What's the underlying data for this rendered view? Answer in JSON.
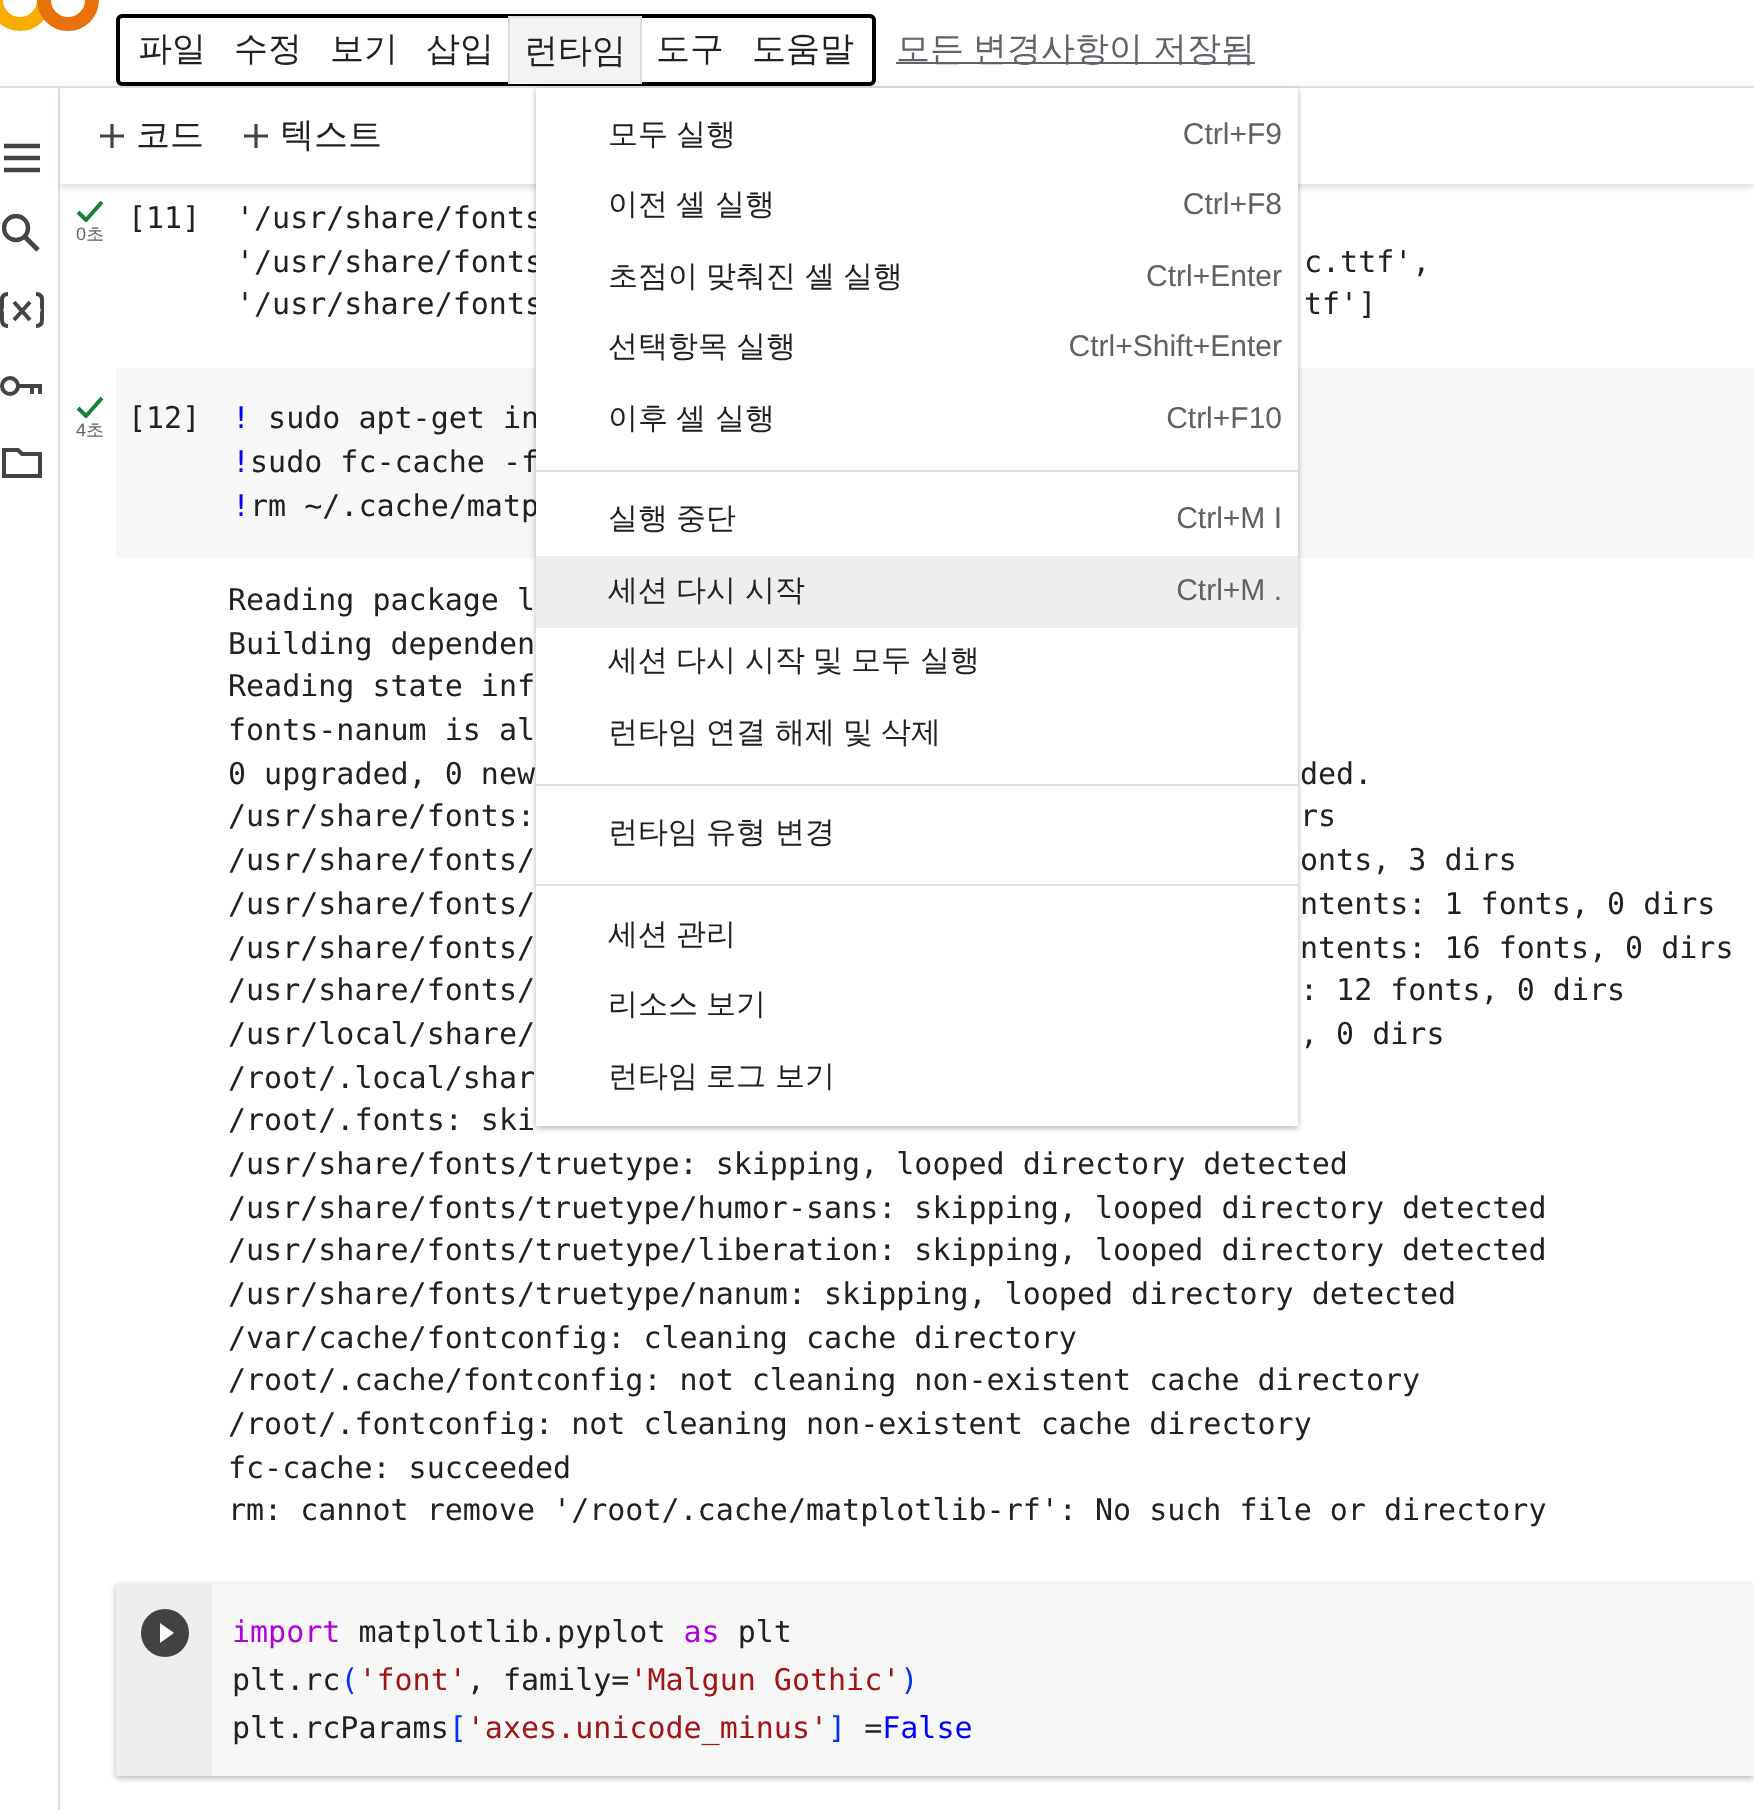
{
  "menubar": {
    "items": [
      {
        "label": "파일",
        "selected": false
      },
      {
        "label": "수정",
        "selected": false
      },
      {
        "label": "보기",
        "selected": false
      },
      {
        "label": "삽입",
        "selected": false
      },
      {
        "label": "런타임",
        "selected": true
      },
      {
        "label": "도구",
        "selected": false
      },
      {
        "label": "도움말",
        "selected": false
      }
    ],
    "save_status": "모든 변경사항이 저장됨"
  },
  "toolbar": {
    "buttons": [
      "코드",
      "텍스트"
    ]
  },
  "cells": [
    {
      "kind": "output_only",
      "status": "0초",
      "count": "[11]",
      "lines": [
        {
          "left": "'/usr/share/fonts"
        },
        {
          "left": "'/usr/share/fonts",
          "right": "c.ttf',"
        },
        {
          "left": "'/usr/share/fonts",
          "right": "tf']"
        }
      ]
    },
    {
      "kind": "shell",
      "status": "4초",
      "count": "[12]",
      "code": [
        {
          "bang": "!",
          "text": " sudo apt-get in"
        },
        {
          "bang": "!",
          "text": "sudo fc-cache -f"
        },
        {
          "bang": "!",
          "text": "rm ~/.cache/matp"
        }
      ],
      "output": [
        {
          "left": "Reading package l"
        },
        {
          "left": "Building dependen"
        },
        {
          "left": "Reading state inf"
        },
        {
          "left": "fonts-nanum is al"
        },
        {
          "left": "0 upgraded, 0 new",
          "right": "ded."
        },
        {
          "left": "/usr/share/fonts:",
          "right": "rs"
        },
        {
          "left": "/usr/share/fonts/",
          "right": "onts, 3 dirs"
        },
        {
          "left": "/usr/share/fonts/",
          "right": "ntents: 1 fonts, 0 dirs"
        },
        {
          "left": "/usr/share/fonts/",
          "right": "ntents: 16 fonts, 0 dirs"
        },
        {
          "left": "/usr/share/fonts/",
          "right": ": 12 fonts, 0 dirs"
        },
        {
          "left": "/usr/local/share/",
          "right": ", 0 dirs"
        },
        {
          "left": "/root/.local/shar"
        },
        {
          "left": "/root/.fonts: ski"
        },
        {
          "left": "/usr/share/fonts/truetype: skipping, looped directory detected"
        },
        {
          "left": "/usr/share/fonts/truetype/humor-sans: skipping, looped directory detected"
        },
        {
          "left": "/usr/share/fonts/truetype/liberation: skipping, looped directory detected"
        },
        {
          "left": "/usr/share/fonts/truetype/nanum: skipping, looped directory detected"
        },
        {
          "left": "/var/cache/fontconfig: cleaning cache directory"
        },
        {
          "left": "/root/.cache/fontconfig: not cleaning non-existent cache directory"
        },
        {
          "left": "/root/.fontconfig: not cleaning non-existent cache directory"
        },
        {
          "left": "fc-cache: succeeded"
        },
        {
          "left": "rm: cannot remove '/root/.cache/matplotlib-rf': No such file or directory"
        }
      ]
    },
    {
      "kind": "python",
      "code": [
        [
          {
            "kind": "keyword",
            "text": "import"
          },
          {
            "kind": "plain",
            "text": " matplotlib.pyplot "
          },
          {
            "kind": "keyword",
            "text": "as"
          },
          {
            "kind": "plain",
            "text": " plt"
          }
        ],
        [
          {
            "kind": "plain",
            "text": "plt.rc"
          },
          {
            "kind": "bracket",
            "text": "("
          },
          {
            "kind": "string",
            "text": "'font'"
          },
          {
            "kind": "plain",
            "text": ", family="
          },
          {
            "kind": "string",
            "text": "'Malgun Gothic'"
          },
          {
            "kind": "bracket",
            "text": ")"
          }
        ],
        [
          {
            "kind": "plain",
            "text": "plt.rcParams"
          },
          {
            "kind": "bracket",
            "text": "["
          },
          {
            "kind": "string",
            "text": "'axes.unicode_minus'"
          },
          {
            "kind": "bracket",
            "text": "]"
          },
          {
            "kind": "plain",
            "text": " ="
          },
          {
            "kind": "constant",
            "text": "False"
          }
        ]
      ]
    }
  ],
  "runtime_menu": {
    "groups": [
      [
        {
          "label": "모두 실행",
          "shortcut": "Ctrl+F9",
          "selected": false
        },
        {
          "label": "이전 셀 실행",
          "shortcut": "Ctrl+F8",
          "selected": false
        },
        {
          "label": "초점이 맞춰진 셀 실행",
          "shortcut": "Ctrl+Enter",
          "selected": false
        },
        {
          "label": "선택항목 실행",
          "shortcut": "Ctrl+Shift+Enter",
          "selected": false
        },
        {
          "label": "이후 셀 실행",
          "shortcut": "Ctrl+F10",
          "selected": false
        }
      ],
      [
        {
          "label": "실행 중단",
          "shortcut": "Ctrl+M I",
          "selected": false
        },
        {
          "label": "세션 다시 시작",
          "shortcut": "Ctrl+M .",
          "selected": true
        },
        {
          "label": "세션 다시 시작 및 모두 실행",
          "selected": false
        },
        {
          "label": "런타임 연결 해제 및 삭제",
          "selected": false
        }
      ],
      [
        {
          "label": "런타임 유형 변경",
          "selected": false
        }
      ],
      [
        {
          "label": "세션 관리",
          "selected": false
        },
        {
          "label": "리소스 보기",
          "selected": false
        },
        {
          "label": "런타임 로그 보기",
          "selected": false
        }
      ]
    ]
  }
}
